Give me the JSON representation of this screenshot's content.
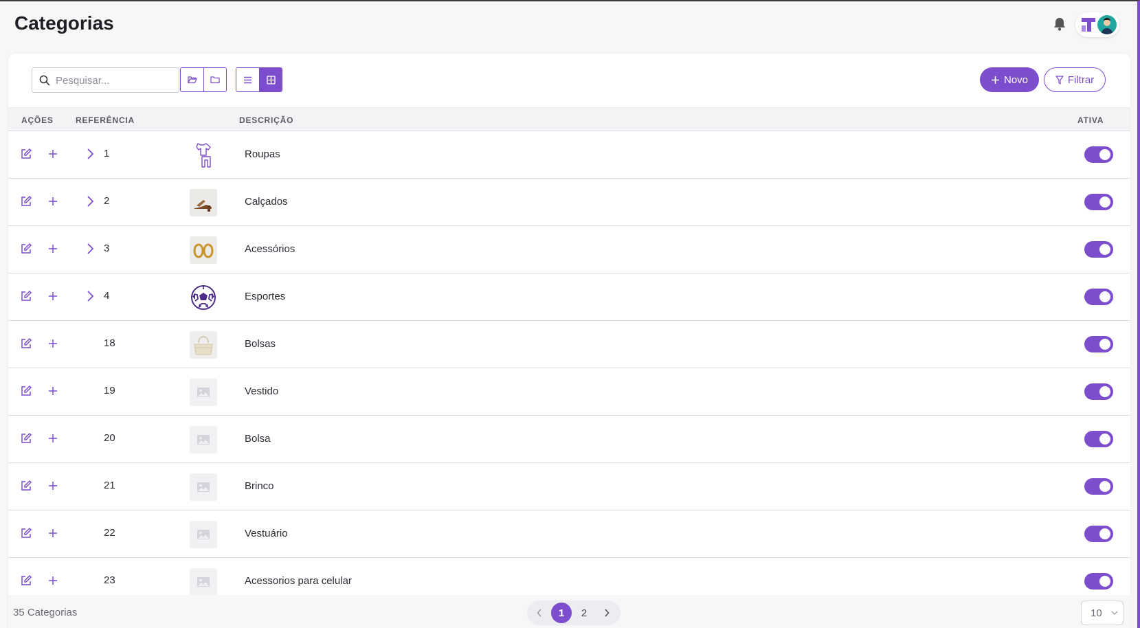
{
  "header": {
    "title": "Categorias"
  },
  "toolbar": {
    "search_placeholder": "Pesquisar...",
    "new_label": "Novo",
    "filter_label": "Filtrar"
  },
  "table": {
    "columns": {
      "actions": "AÇÕES",
      "reference": "REFERÊNCIA",
      "description": "DESCRIÇÃO",
      "active": "ATIVA"
    },
    "rows": [
      {
        "ref": "1",
        "description": "Roupas",
        "expandable": true,
        "image": "clothes-icon",
        "active": true
      },
      {
        "ref": "2",
        "description": "Calçados",
        "expandable": true,
        "image": "sandal-image",
        "active": true
      },
      {
        "ref": "3",
        "description": "Acessórios",
        "expandable": true,
        "image": "earrings-image",
        "active": true
      },
      {
        "ref": "4",
        "description": "Esportes",
        "expandable": true,
        "image": "soccer-ball-icon",
        "active": true
      },
      {
        "ref": "18",
        "description": "Bolsas",
        "expandable": false,
        "image": "handbag-image",
        "active": true
      },
      {
        "ref": "19",
        "description": "Vestido",
        "expandable": false,
        "image": "image-placeholder-icon",
        "active": true
      },
      {
        "ref": "20",
        "description": "Bolsa",
        "expandable": false,
        "image": "image-placeholder-icon",
        "active": true
      },
      {
        "ref": "21",
        "description": "Brinco",
        "expandable": false,
        "image": "image-placeholder-icon",
        "active": true
      },
      {
        "ref": "22",
        "description": "Vestuário",
        "expandable": false,
        "image": "image-placeholder-icon",
        "active": true
      },
      {
        "ref": "23",
        "description": "Acessorios para celular",
        "expandable": false,
        "image": "image-placeholder-icon",
        "active": true
      }
    ]
  },
  "footer": {
    "count_label": "35 Categorias",
    "pages": [
      "1",
      "2"
    ],
    "current_page": "1",
    "page_size": "10"
  },
  "colors": {
    "accent": "#7c4dcc",
    "header_bg": "#f3f3f6"
  }
}
